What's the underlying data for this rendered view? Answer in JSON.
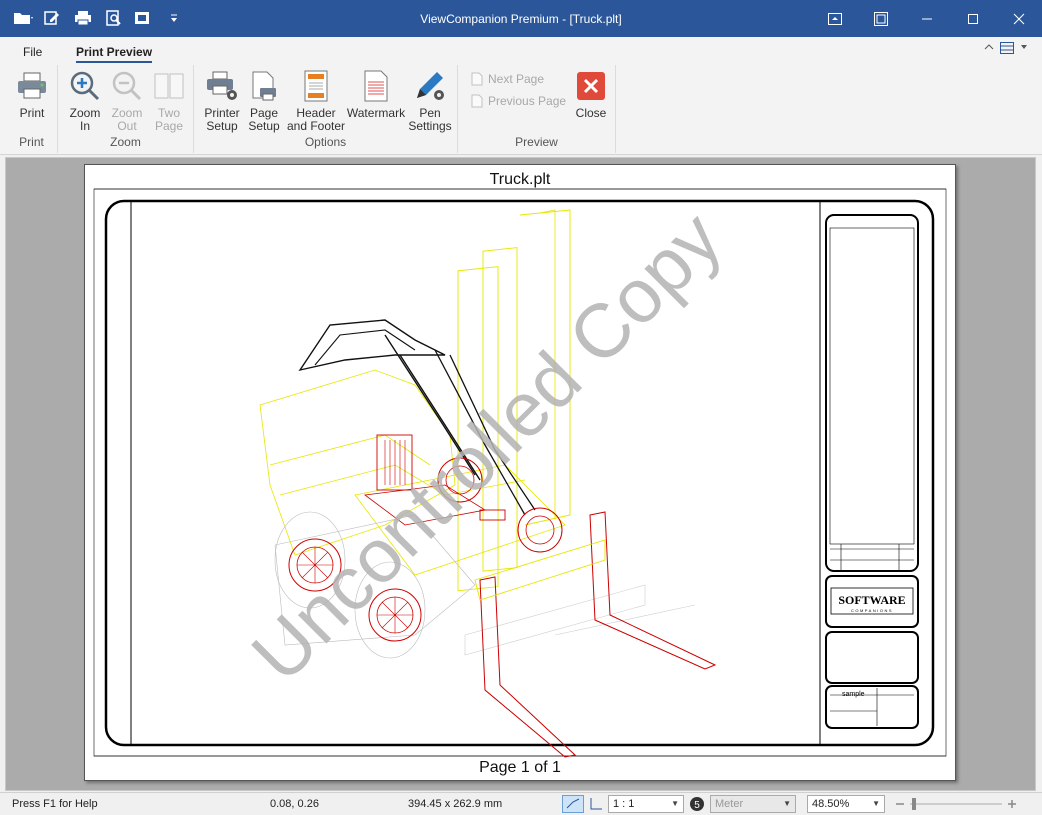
{
  "window": {
    "title": "ViewCompanion Premium - [Truck.plt]"
  },
  "tabs": {
    "file": "File",
    "print_preview": "Print Preview"
  },
  "ribbon": {
    "print_group": {
      "label": "Print",
      "print": "Print"
    },
    "zoom_group": {
      "label": "Zoom",
      "zoom_in": [
        "Zoom",
        "In"
      ],
      "zoom_out": [
        "Zoom",
        "Out"
      ],
      "two_page": [
        "Two",
        "Page"
      ]
    },
    "options_group": {
      "label": "Options",
      "printer_setup": [
        "Printer",
        "Setup"
      ],
      "page_setup": [
        "Page",
        "Setup"
      ],
      "header_footer": [
        "Header",
        "and Footer"
      ],
      "watermark": "Watermark",
      "pen_settings": [
        "Pen",
        "Settings"
      ]
    },
    "preview_group": {
      "label": "Preview",
      "next_page": "Next Page",
      "previous_page": "Previous Page",
      "close": "Close"
    }
  },
  "preview": {
    "header": "Truck.plt",
    "footer": "Page 1 of 1",
    "watermark": "Uncontrolled Copy",
    "title_block": {
      "logo_top": "SOFTWARE",
      "logo_bottom": "COMPANIONS",
      "sample": "sample"
    }
  },
  "status": {
    "help": "Press F1 for Help",
    "coords": "0.08, 0.26",
    "size": "394.45 x 262.9 mm",
    "scale": "1 : 1",
    "unit": "Meter",
    "zoom": "48.50%"
  },
  "colors": {
    "titlebar": "#2b579a",
    "close_red": "#e04a3a",
    "drawing_yellow": "#e6e600",
    "drawing_red": "#cc0000"
  }
}
